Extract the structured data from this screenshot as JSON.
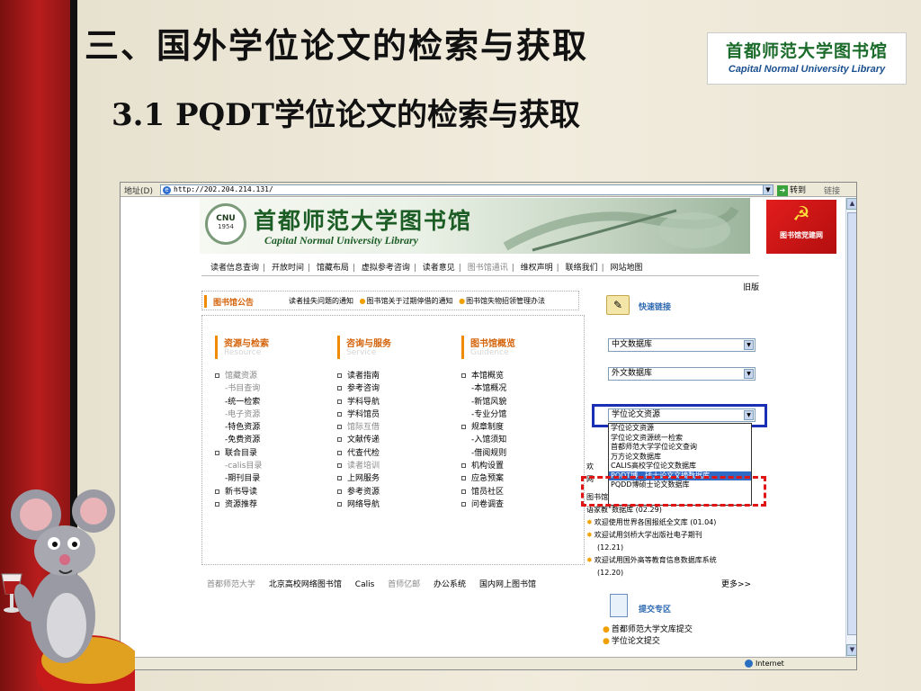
{
  "slide": {
    "title": "三、国外学位论文的检索与获取",
    "subtitle": "3.1  PQDT学位论文的检索与获取",
    "logo": {
      "cn": "首都师范大学图书馆",
      "en": "Capital Normal University Library"
    }
  },
  "browser": {
    "address_label": "地址(D)",
    "url": "http://202.204.214.131/",
    "go_label": "转到",
    "links_label": "链接",
    "status_zone": "Internet"
  },
  "site": {
    "banner_cn": "首都师范大学图书馆",
    "banner_en": "Capital Normal University Library",
    "seal_text": "CNU",
    "seal_year": "1954",
    "party_label": "图书馆党建网",
    "nav": [
      "读者信息查询",
      "开放时间",
      "馆藏布局",
      "虚拟参考咨询",
      "读者意见",
      "图书馆通讯",
      "维权声明",
      "联络我们",
      "网站地图"
    ],
    "old_version": "旧版",
    "notice_title": "图书馆公告",
    "notices": [
      "读者挂失问题的通知",
      "图书馆关于过期停借的通知",
      "图书馆失物招领管理办法"
    ],
    "quick_links_title": "快速链接",
    "selects": {
      "chinese_db": "中文数据库",
      "foreign_db": "外文数据库",
      "thesis_db": "学位论文资源"
    },
    "dropdown_options": [
      "学位论文资源",
      "学位论文资源统一检索",
      "首都师范大学学位论文查询",
      "万方论文数据库",
      "CALIS高校学位论文数据库",
      "PQDT博、硕士论文文摘数据库",
      "PQDD博硕士论文数据库"
    ],
    "dropdown_selected_index": 5,
    "columns": [
      {
        "title": "资源与检索",
        "subtitle": "Resource",
        "items": [
          {
            "text": "馆藏资源",
            "bullet": true,
            "dim": true
          },
          {
            "text": "-书目查询",
            "bullet": false,
            "dim": true
          },
          {
            "text": "-统一检索",
            "bullet": false,
            "dim": false
          },
          {
            "text": "-电子资源",
            "bullet": false,
            "dim": true
          },
          {
            "text": "-特色资源",
            "bullet": false,
            "dim": false
          },
          {
            "text": "-免费资源",
            "bullet": false,
            "dim": false
          },
          {
            "text": "联合目录",
            "bullet": true,
            "dim": false
          },
          {
            "text": "-calis目录",
            "bullet": false,
            "dim": true
          },
          {
            "text": "-期刊目录",
            "bullet": false,
            "dim": false
          },
          {
            "text": "新书导读",
            "bullet": true,
            "dim": false
          },
          {
            "text": "资源推荐",
            "bullet": true,
            "dim": false
          }
        ]
      },
      {
        "title": "咨询与服务",
        "subtitle": "Service",
        "items": [
          {
            "text": "读者指南",
            "bullet": true,
            "dim": false
          },
          {
            "text": "参考咨询",
            "bullet": true,
            "dim": false
          },
          {
            "text": "学科导航",
            "bullet": true,
            "dim": false
          },
          {
            "text": "学科馆员",
            "bullet": true,
            "dim": false
          },
          {
            "text": "馆际互借",
            "bullet": true,
            "dim": true
          },
          {
            "text": "文献传递",
            "bullet": true,
            "dim": false
          },
          {
            "text": "代查代检",
            "bullet": true,
            "dim": false
          },
          {
            "text": "读者培训",
            "bullet": true,
            "dim": true
          },
          {
            "text": "上网服务",
            "bullet": true,
            "dim": false
          },
          {
            "text": "参考资源",
            "bullet": true,
            "dim": false
          },
          {
            "text": "网络导航",
            "bullet": true,
            "dim": false
          }
        ]
      },
      {
        "title": "图书馆概览",
        "subtitle": "Guidence",
        "items": [
          {
            "text": "本馆概览",
            "bullet": true,
            "dim": false
          },
          {
            "text": "-本馆概况",
            "bullet": false,
            "dim": false
          },
          {
            "text": "-新馆风貌",
            "bullet": false,
            "dim": false
          },
          {
            "text": "-专业分馆",
            "bullet": false,
            "dim": false
          },
          {
            "text": "规章制度",
            "bullet": true,
            "dim": false
          },
          {
            "text": "-入馆须知",
            "bullet": false,
            "dim": false
          },
          {
            "text": "-借阅规则",
            "bullet": false,
            "dim": false
          },
          {
            "text": "机构设置",
            "bullet": true,
            "dim": false
          },
          {
            "text": "应急预案",
            "bullet": true,
            "dim": false
          },
          {
            "text": "馆员社区",
            "bullet": true,
            "dim": false
          },
          {
            "text": "问卷调查",
            "bullet": true,
            "dim": false
          }
        ]
      }
    ],
    "news": [
      {
        "text": "欢",
        "date": ""
      },
      {
        "text": "网",
        "date": ""
      },
      {
        "text": "图书馆最新开通试用“Myet,我的英语口",
        "date": ""
      },
      {
        "text": "语家教”数据库 (02.29)",
        "date": ""
      },
      {
        "text": "欢迎使用世界各国报纸全文库 (01.04)",
        "date": ""
      },
      {
        "text": "欢迎试用剑桥大学出版社电子期刊",
        "date": "(12.21)"
      },
      {
        "text": "欢迎试用国外高等教育信息数据库系统",
        "date": "(12.20)"
      }
    ],
    "footer_links": [
      "首都师范大学",
      "北京高校网络图书馆",
      "Calis",
      "首师亿邮",
      "办公系统",
      "国内网上图书馆"
    ],
    "more_label": "更多>>",
    "submit_title": "提交专区",
    "submit_links": [
      "首都师范大学文库提交",
      "学位论文提交"
    ]
  },
  "colors": {
    "accent_orange": "#f08a00",
    "highlight_blue": "#316ac5",
    "frame_blue": "#1b2fb5",
    "frame_red": "#e01515",
    "banner_green": "#1b5d25"
  }
}
